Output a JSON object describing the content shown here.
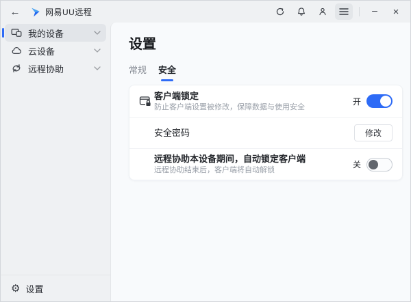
{
  "app": {
    "title": "网易UU远程"
  },
  "titlebar": {
    "back_glyph": "←",
    "minimize_glyph": "–",
    "close_glyph": "×"
  },
  "sidebar": {
    "items": [
      {
        "label": "我的设备",
        "icon": "devices-icon",
        "selected": true
      },
      {
        "label": "云设备",
        "icon": "cloud-icon",
        "selected": false
      },
      {
        "label": "远程协助",
        "icon": "remote-assist-icon",
        "selected": false
      }
    ],
    "footer_label": "设置",
    "gear_glyph": "⚙"
  },
  "page": {
    "title": "设置",
    "tabs": [
      {
        "label": "常规",
        "active": false
      },
      {
        "label": "安全",
        "active": true
      }
    ]
  },
  "settings": {
    "rows": [
      {
        "title": "客户端锁定",
        "description": "防止客户端设置被修改，保障数据与使用安全",
        "control": "toggle",
        "toggle_label": "开",
        "toggle_state": "on"
      },
      {
        "title": "安全密码",
        "control": "button",
        "button_label": "修改"
      },
      {
        "title": "远程协助本设备期间，自动锁定客户端",
        "description": "远程协助结束后，客户端将自动解锁",
        "control": "toggle",
        "toggle_label": "关",
        "toggle_state": "off"
      }
    ]
  },
  "colors": {
    "accent": "#2e6bf6",
    "toggle_off_knob": "#62666d",
    "sidebar_bg": "#eff1f3",
    "panel_bg": "#f8fafc",
    "card_bg": "#ffffff"
  }
}
